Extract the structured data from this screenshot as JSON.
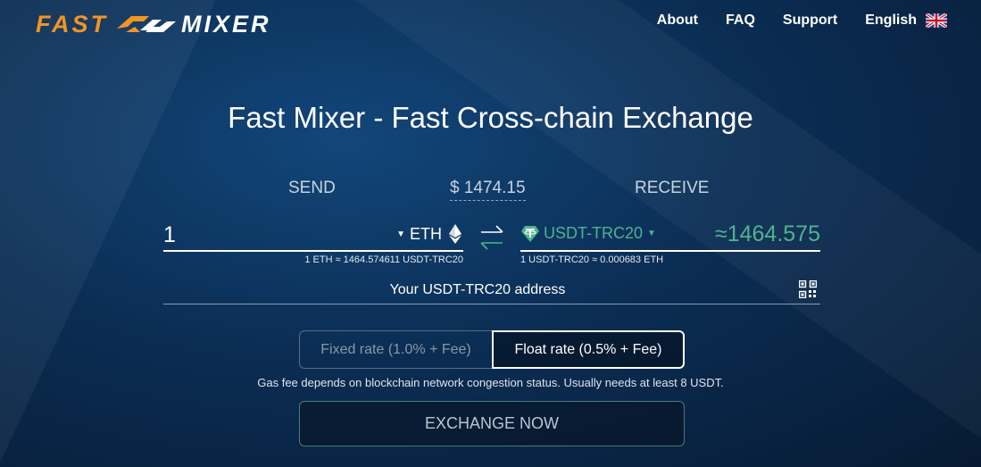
{
  "header": {
    "logo_left": "FAST",
    "logo_right": "MIXER",
    "nav": [
      "About",
      "FAQ",
      "Support"
    ],
    "language": "English",
    "flag_icon": "uk-flag-icon"
  },
  "main": {
    "title": "Fast Mixer - Fast Cross-chain Exchange",
    "send_label": "SEND",
    "usd_value": "$ 1474.15",
    "receive_label": "RECEIVE",
    "send": {
      "amount": "1",
      "currency": "ETH",
      "icon": "ethereum-icon",
      "rate": "1 ETH ≈ 1464.574611 USDT-TRC20"
    },
    "receive": {
      "currency": "USDT-TRC20",
      "icon": "tether-icon",
      "amount": "≈1464.575",
      "rate": "1 USDT-TRC20 ≈ 0.000683 ETH"
    },
    "address_placeholder": "Your USDT-TRC20 address",
    "rate_options": {
      "fixed": "Fixed rate (1.0% + Fee)",
      "float": "Float rate (0.5% + Fee)",
      "selected": "float"
    },
    "gas_note": "Gas fee depends on blockchain network congestion status. Usually needs at least 8 USDT.",
    "exchange_button": "EXCHANGE NOW"
  },
  "colors": {
    "brand_orange": "#f29423",
    "accent_green": "#4fb38f",
    "background": "#0b2e55"
  }
}
